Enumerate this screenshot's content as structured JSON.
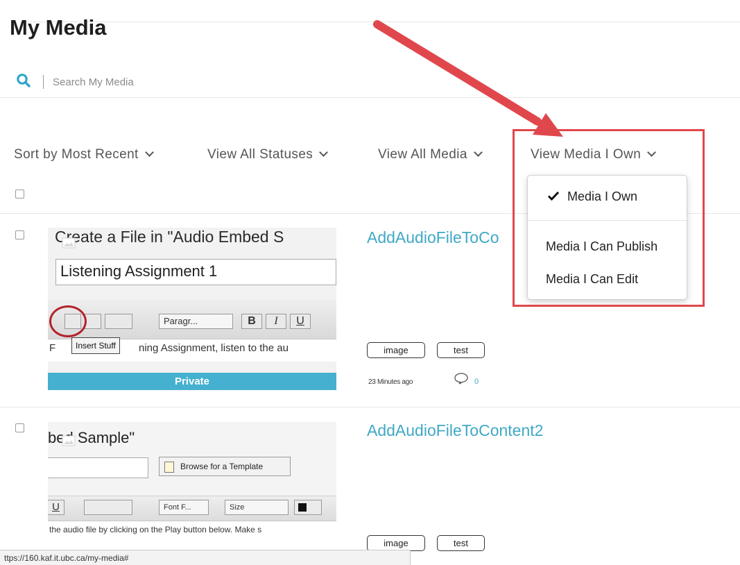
{
  "page": {
    "title": "My Media"
  },
  "search": {
    "placeholder": "Search My Media"
  },
  "filters": {
    "sort": "Sort by Most Recent",
    "status": "View All Statuses",
    "media": "View All Media",
    "owner": "View Media I Own"
  },
  "owner_dropdown": {
    "items": [
      "Media I Own",
      "Media I Can Publish",
      "Media I Can Edit"
    ],
    "selected_index": 0
  },
  "entries": [
    {
      "title": "AddAudioFileToCo",
      "thumbnail": {
        "heading": "Create a File in \"Audio Embed S",
        "field_value": "Listening Assignment 1",
        "format_dropdown": "Paragr...",
        "tooltip": "Insert Stuff",
        "body_text": "ning Assignment, listen to the au",
        "body_prefix": "F",
        "status_label": "Private"
      },
      "tags": [
        "image",
        "test"
      ],
      "time": "23 Minutes ago",
      "comments": "0"
    },
    {
      "title": "AddAudioFileToContent2",
      "thumbnail": {
        "heading": "bed Sample\"",
        "template_button": "Browse for a Template",
        "font_dropdown": "Font F...",
        "size_dropdown": "Size",
        "body_text": "the audio file by clicking on the Play button below.  Make s"
      },
      "tags": [
        "image",
        "test"
      ]
    }
  ],
  "status_bar": {
    "url": "ttps://160.kaf.it.ubc.ca/my-media#"
  },
  "colors": {
    "accent": "#3fa8c5",
    "annotation_red": "#e0474c",
    "private_bar": "#45b0cf"
  }
}
